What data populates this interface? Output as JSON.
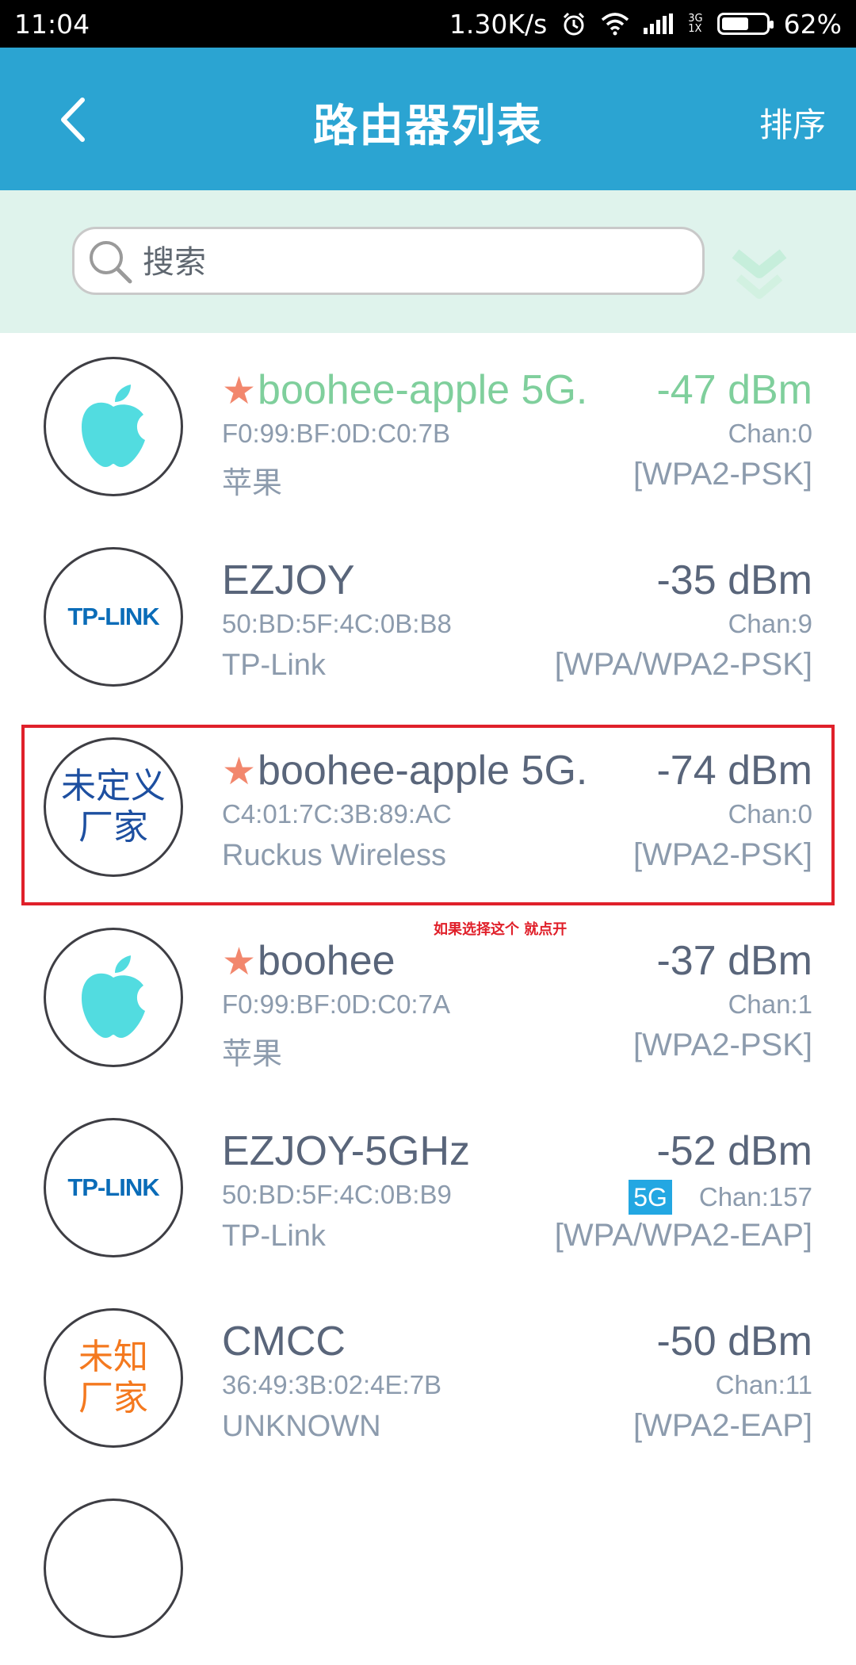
{
  "status_bar": {
    "time": "11:04",
    "speed": "1.30K/s",
    "net_type_top": "3G",
    "net_type_bottom": "1X",
    "battery": "62%",
    "battery_level": 0.62
  },
  "header": {
    "title": "路由器列表",
    "sort_label": "排序"
  },
  "search": {
    "placeholder": "搜索"
  },
  "routers": [
    {
      "logo": "apple-logo",
      "starred": true,
      "ssid": "boohee-apple 5G.",
      "mac": "F0:99:BF:0D:C0:7B",
      "vendor": "苹果",
      "dbm": "-47 dBm",
      "chan": "Chan:0",
      "security": "[WPA2-PSK]",
      "connected": true
    },
    {
      "logo": "tplink-logo",
      "logo_text": "TP-LINK",
      "starred": false,
      "ssid": "EZJOY",
      "mac": "50:BD:5F:4C:0B:B8",
      "vendor": "TP-Link",
      "dbm": "-35 dBm",
      "chan": "Chan:9",
      "security": "[WPA/WPA2-PSK]"
    },
    {
      "logo": "undefined-vendor-logo",
      "logo_line1": "未定义",
      "logo_line2": "厂家",
      "starred": true,
      "ssid": "boohee-apple 5G.",
      "mac": "C4:01:7C:3B:89:AC",
      "vendor": "Ruckus Wireless",
      "dbm": "-74 dBm",
      "chan": "Chan:0",
      "security": "[WPA2-PSK]"
    },
    {
      "logo": "apple-logo",
      "starred": true,
      "ssid": "boohee",
      "mac": "F0:99:BF:0D:C0:7A",
      "vendor": "苹果",
      "dbm": "-37 dBm",
      "chan": "Chan:1",
      "security": "[WPA2-PSK]"
    },
    {
      "logo": "tplink-logo",
      "logo_text": "TP-LINK",
      "starred": false,
      "ssid": "EZJOY-5GHz",
      "mac": "50:BD:5F:4C:0B:B9",
      "vendor": "TP-Link",
      "dbm": "-52 dBm",
      "band_badge": "5G",
      "chan": "Chan:157",
      "security": "[WPA/WPA2-EAP]"
    },
    {
      "logo": "unknown-vendor-logo",
      "logo_line1": "未知",
      "logo_line2": "厂家",
      "starred": false,
      "ssid": "CMCC",
      "mac": "36:49:3B:02:4E:7B",
      "vendor": "UNKNOWN",
      "dbm": "-50 dBm",
      "chan": "Chan:11",
      "security": "[WPA2-EAP]"
    }
  ],
  "annotation": "如果选择这个 就点开",
  "colors": {
    "header_bg": "#2ba4d2",
    "search_region_bg": "#dff3ec",
    "connected_green": "#7fcf9c",
    "star": "#f2876d",
    "highlight_red": "#e0202a"
  }
}
